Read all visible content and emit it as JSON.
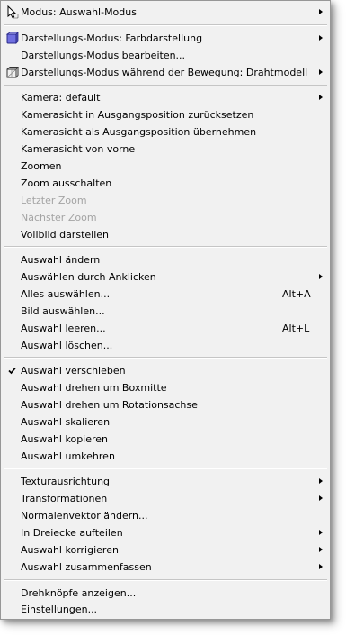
{
  "menu": {
    "items": [
      {
        "label": "Modus:  Auswahl-Modus",
        "icon": "cursor-icon",
        "submenu": true
      },
      {
        "label": "Darstellungs-Modus: Farbdarstellung",
        "icon": "cube-icon",
        "submenu": true
      },
      {
        "label": "Darstellungs-Modus bearbeiten..."
      },
      {
        "label": "Darstellungs-Modus während der Bewegung: Drahtmodell",
        "icon": "wireframe-icon",
        "submenu": true
      },
      {
        "label": "Kamera: default",
        "submenu": true
      },
      {
        "label": "Kamerasicht in Ausgangsposition zurücksetzen"
      },
      {
        "label": "Kamerasicht als Ausgangsposition übernehmen"
      },
      {
        "label": "Kamerasicht von vorne"
      },
      {
        "label": "Zoomen"
      },
      {
        "label": "Zoom ausschalten"
      },
      {
        "label": "Letzter Zoom",
        "disabled": true
      },
      {
        "label": "Nächster Zoom",
        "disabled": true
      },
      {
        "label": "Vollbild darstellen"
      },
      {
        "label": "Auswahl ändern"
      },
      {
        "label": "Auswählen durch Anklicken",
        "submenu": true
      },
      {
        "label": "Alles auswählen...",
        "shortcut": "Alt+A"
      },
      {
        "label": "Bild auswählen..."
      },
      {
        "label": "Auswahl leeren...",
        "shortcut": "Alt+L"
      },
      {
        "label": "Auswahl löschen..."
      },
      {
        "label": "Auswahl verschieben",
        "checked": true
      },
      {
        "label": "Auswahl drehen um Boxmitte"
      },
      {
        "label": "Auswahl drehen um Rotationsachse"
      },
      {
        "label": "Auswahl skalieren"
      },
      {
        "label": "Auswahl kopieren"
      },
      {
        "label": "Auswahl umkehren"
      },
      {
        "label": "Texturausrichtung",
        "submenu": true
      },
      {
        "label": "Transformationen",
        "submenu": true
      },
      {
        "label": "Normalenvektor ändern..."
      },
      {
        "label": "In Dreiecke aufteilen",
        "submenu": true
      },
      {
        "label": "Auswahl korrigieren",
        "submenu": true
      },
      {
        "label": "Auswahl zusammenfassen",
        "submenu": true
      },
      {
        "label": "Drehknöpfe anzeigen..."
      },
      {
        "label": "Einstellungen..."
      }
    ]
  }
}
